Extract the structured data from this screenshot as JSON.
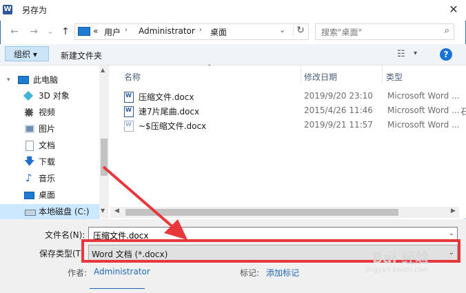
{
  "window": {
    "title": "另存为",
    "close": "✕"
  },
  "nav": {
    "back": "←",
    "forward": "→",
    "dropdown": "⌄",
    "up": "↑"
  },
  "address": {
    "overflow": "«",
    "crumbs": [
      "用户",
      "Administrator",
      "桌面"
    ],
    "sep": "›",
    "dropdown": "⌄",
    "refresh": "↻"
  },
  "search": {
    "placeholder": "搜索\"桌面\"",
    "icon": "⌕"
  },
  "toolbar": {
    "organize": "组织 ▾",
    "new_folder": "新建文件夹",
    "view": "☷",
    "view_dd": "▾",
    "help": "?"
  },
  "sidebar": {
    "items": [
      {
        "label": "此电脑",
        "icon": "pc-icon",
        "color": "#1d7bd1"
      },
      {
        "label": "3D 对象",
        "icon": "cube-icon",
        "color": "#3fb6d9"
      },
      {
        "label": "视频",
        "icon": "video-icon",
        "color": "#555555"
      },
      {
        "label": "图片",
        "icon": "picture-icon",
        "color": "#6a8fb5"
      },
      {
        "label": "文档",
        "icon": "document-icon",
        "color": "#8aa0b8"
      },
      {
        "label": "下载",
        "icon": "download-icon",
        "color": "#1d6fd1"
      },
      {
        "label": "音乐",
        "icon": "music-icon",
        "color": "#1d6fd1"
      },
      {
        "label": "桌面",
        "icon": "desktop-icon",
        "color": "#1d7bd1"
      },
      {
        "label": "本地磁盘 (C:)",
        "icon": "drive-icon",
        "color": "#5c7ea8"
      }
    ]
  },
  "files": {
    "columns": [
      "名称",
      "修改日期",
      "类型"
    ],
    "sort_indicator": "⌃",
    "rows": [
      {
        "name": "压缩文件.docx",
        "date": "2019/9/20 23:10",
        "type": "Microsoft Word ..."
      },
      {
        "name": "速7片尾曲.docx",
        "date": "2015/4/26 11:46",
        "type": "Microsoft Word ..."
      },
      {
        "name": "~$压缩文件.docx",
        "date": "2019/9/21 11:57",
        "type": "Microsoft Word ..."
      }
    ],
    "clipped_char": "石"
  },
  "form": {
    "filename_label": "文件名(N):",
    "filename_value": "压缩文件.docx",
    "filetype_label": "保存类型(T",
    "filetype_value": "Word 文档 (*.docx)",
    "author_label": "作者:",
    "author_value": "Administrator",
    "tags_label": "标记:",
    "tags_value": "添加标记"
  },
  "watermark": {
    "brand": "Bai 经验",
    "url": "jingyan.baidu.com"
  },
  "accent": "#e8363d"
}
